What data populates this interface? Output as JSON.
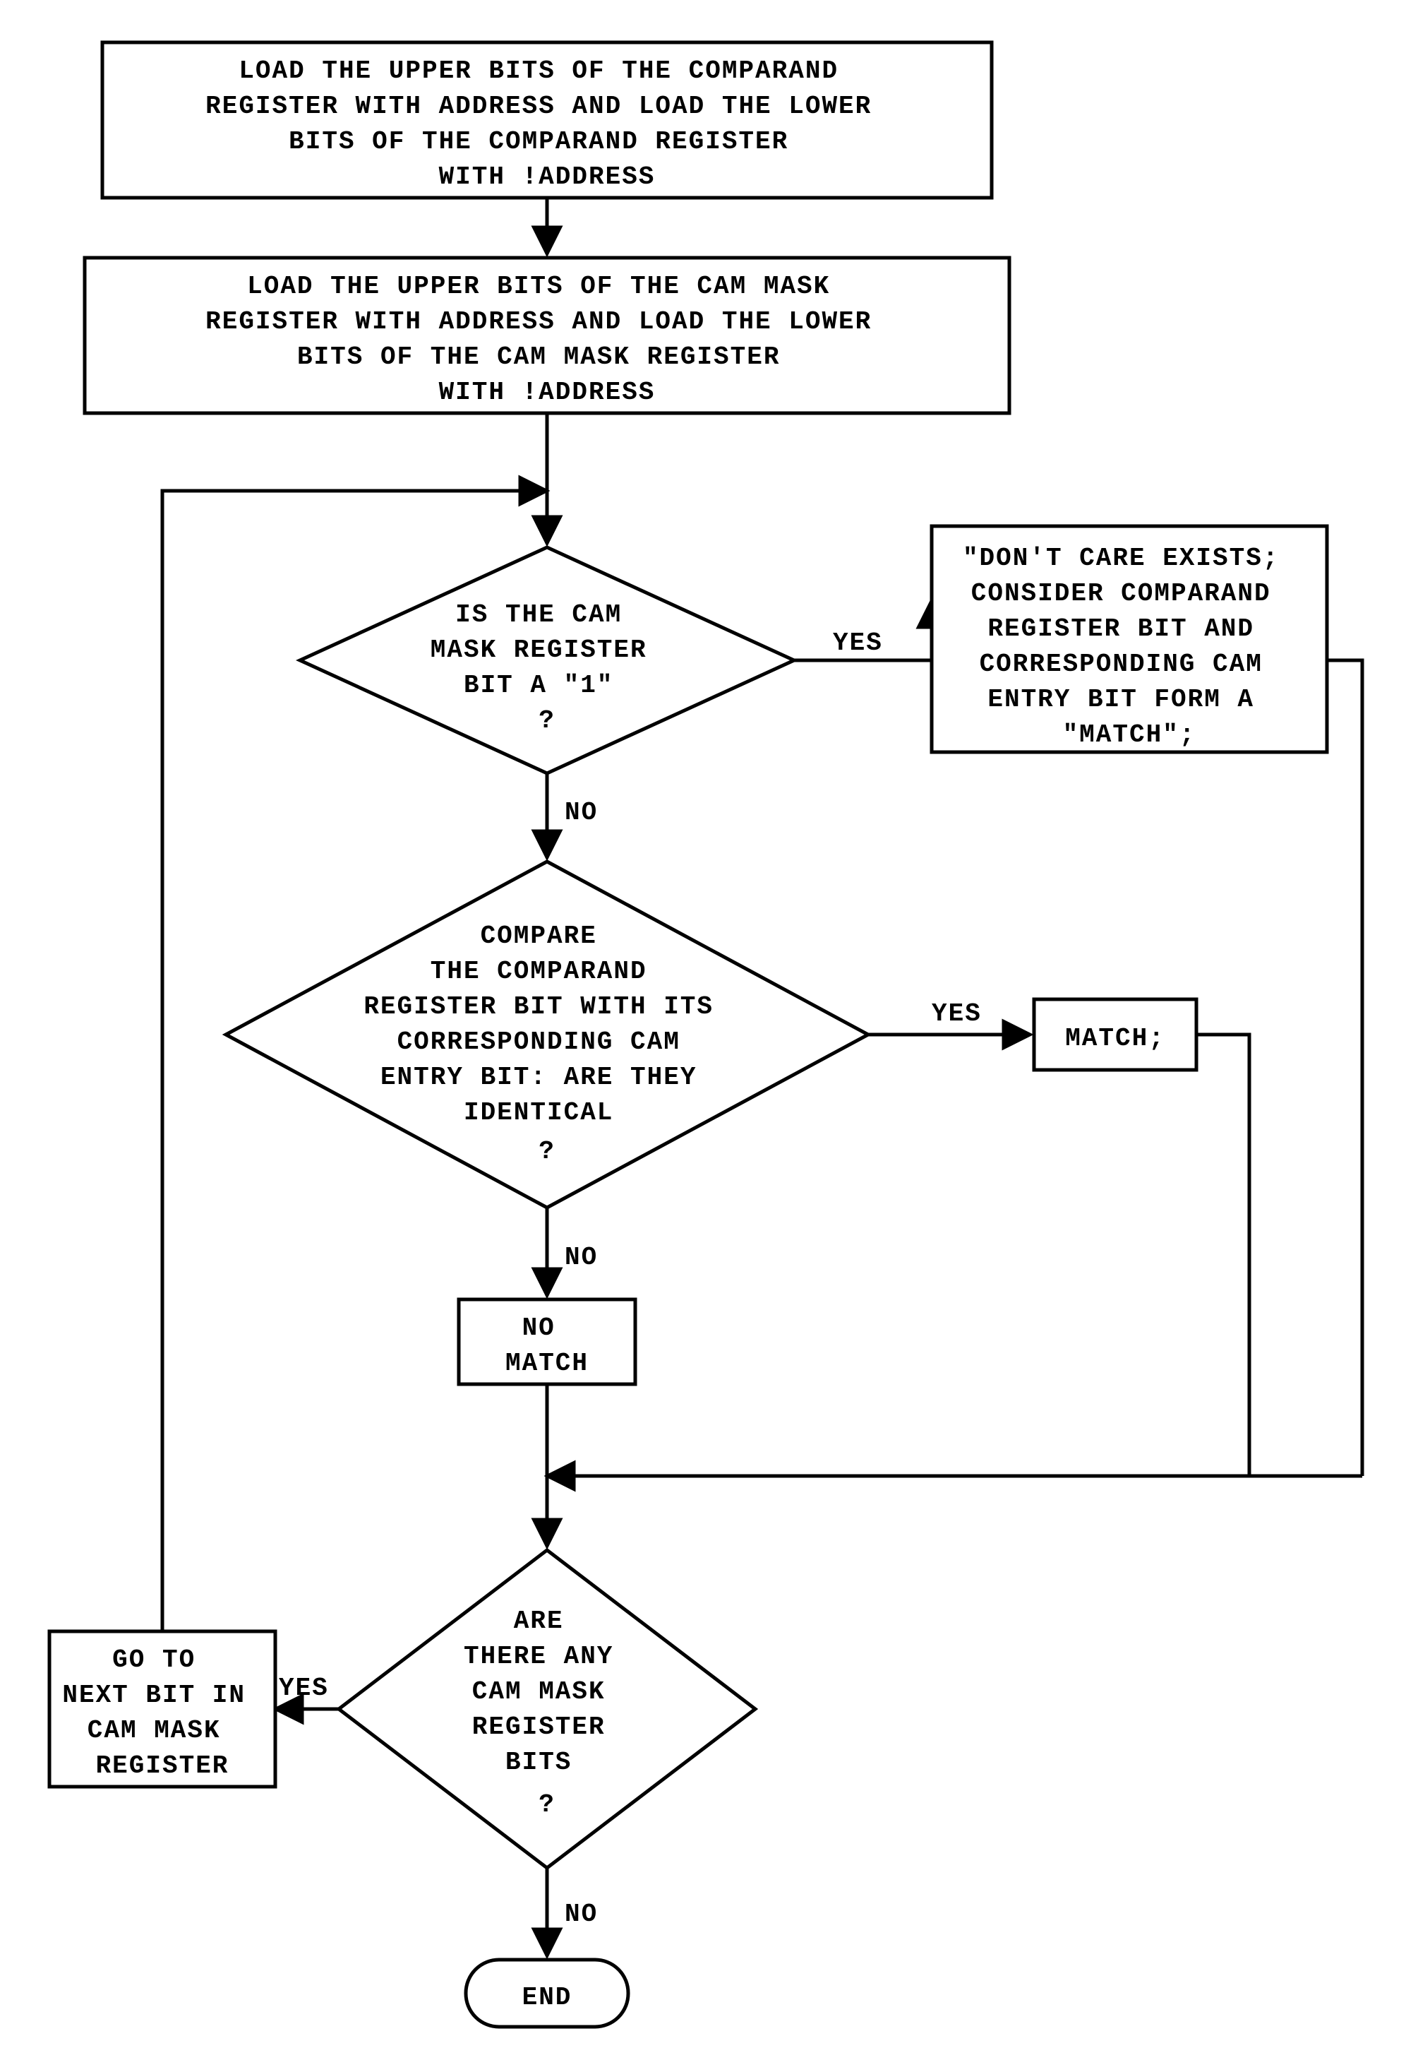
{
  "nodes": {
    "step1": {
      "lines": [
        "LOAD THE UPPER BITS OF THE COMPARAND",
        "REGISTER WITH ADDRESS AND LOAD THE LOWER",
        "BITS OF THE COMPARAND REGISTER",
        "WITH !ADDRESS"
      ]
    },
    "step2": {
      "lines": [
        "LOAD THE UPPER BITS OF THE CAM MASK",
        "REGISTER WITH ADDRESS AND LOAD THE LOWER",
        "BITS OF THE CAM MASK   REGISTER",
        "WITH !ADDRESS"
      ]
    },
    "decision1": {
      "lines": [
        "IS THE CAM",
        "MASK REGISTER",
        "BIT A \"1\"",
        "?"
      ]
    },
    "dontcare": {
      "lines": [
        "\"DON'T CARE EXISTS;",
        "CONSIDER COMPARAND",
        "REGISTER BIT AND",
        "CORRESPONDING CAM",
        "ENTRY BIT FORM A",
        "\"MATCH\";"
      ]
    },
    "decision2": {
      "lines": [
        "COMPARE",
        "THE COMPARAND",
        "REGISTER BIT WITH ITS",
        "CORRESPONDING CAM",
        "ENTRY BIT: ARE THEY",
        "IDENTICAL",
        "?"
      ]
    },
    "match": {
      "lines": [
        "MATCH;"
      ]
    },
    "nomatch": {
      "lines": [
        "NO",
        "MATCH"
      ]
    },
    "decision3": {
      "lines": [
        "ARE",
        "THERE ANY",
        "CAM MASK",
        "REGISTER",
        "BITS",
        "?"
      ]
    },
    "nextbit": {
      "lines": [
        "GO TO",
        "NEXT BIT IN",
        "CAM MASK",
        "REGISTER"
      ]
    },
    "end": {
      "lines": [
        "END"
      ]
    }
  },
  "labels": {
    "yes": "YES",
    "no": "NO"
  }
}
